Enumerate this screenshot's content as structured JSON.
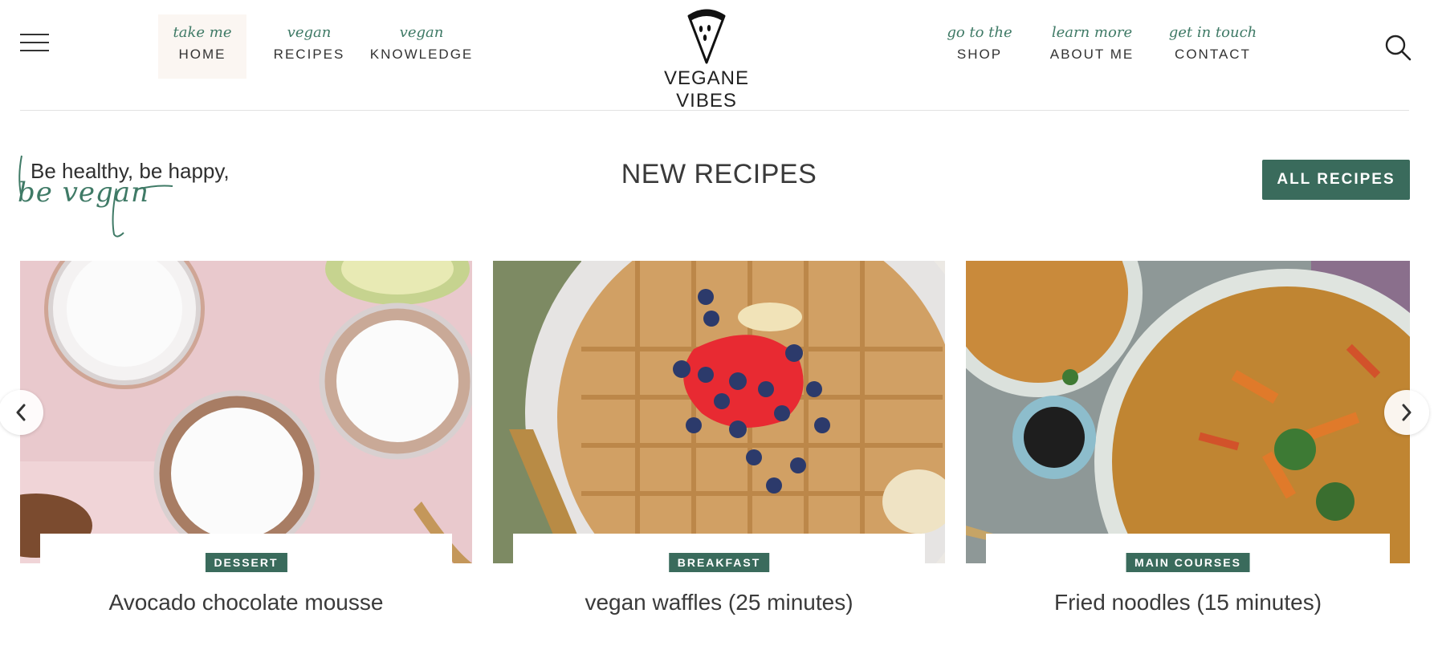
{
  "header": {
    "nav_left": [
      {
        "kicker": "take me",
        "label": "HOME"
      },
      {
        "kicker": "vegan",
        "label": "RECIPES"
      },
      {
        "kicker": "vegan",
        "label": "KNOWLEDGE"
      }
    ],
    "nav_right": [
      {
        "kicker": "go to the",
        "label": "SHOP"
      },
      {
        "kicker": "learn more",
        "label": "ABOUT ME"
      },
      {
        "kicker": "get in touch",
        "label": "CONTACT"
      }
    ],
    "logo_text": "VEGANE VIBES"
  },
  "section": {
    "tagline_line1": "Be healthy, be happy,",
    "tagline_line2": "be vegan",
    "title": "NEW RECIPES",
    "all_button": "ALL RECIPES"
  },
  "recipes": [
    {
      "category": "DESSERT",
      "title": "Avocado chocolate mousse"
    },
    {
      "category": "BREAKFAST",
      "title": "vegan waffles (25 minutes)"
    },
    {
      "category": "MAIN COURSES",
      "title": "Fried noodles (15 minutes)"
    }
  ],
  "colors": {
    "accent": "#3a6b5c",
    "kicker": "#3f7a66"
  },
  "icons": {
    "menu": "hamburger-icon",
    "search": "search-icon",
    "prev": "chevron-left-icon",
    "next": "chevron-right-icon"
  }
}
